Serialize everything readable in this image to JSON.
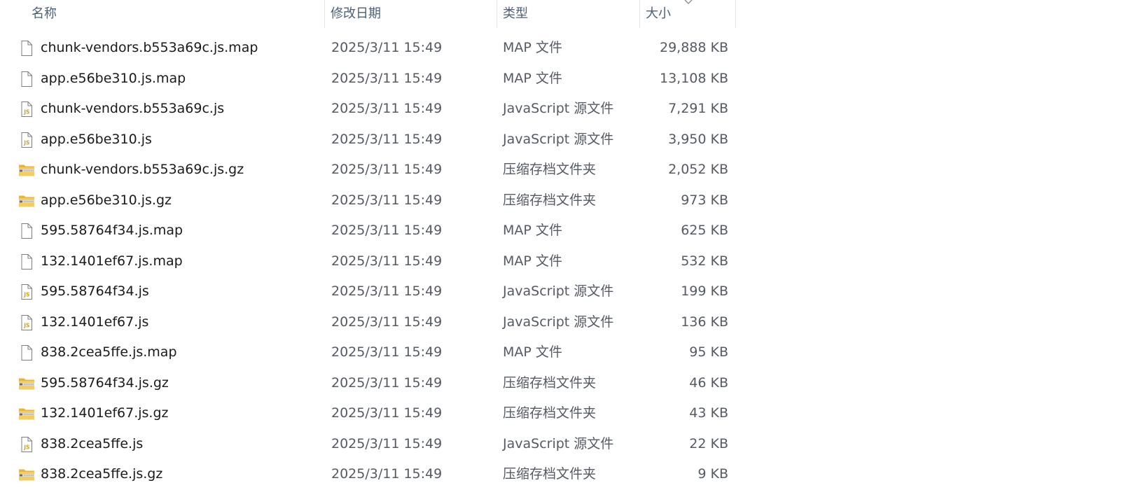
{
  "columns": {
    "name": "名称",
    "date": "修改日期",
    "type": "类型",
    "size": "大小"
  },
  "sort": {
    "column": "size",
    "direction": "descending",
    "icon": "chevron-down-icon"
  },
  "files": [
    {
      "name": "chunk-vendors.b553a69c.js.map",
      "date": "2025/3/11 15:49",
      "type": "MAP 文件",
      "size": "29,888 KB",
      "icon": "file-icon"
    },
    {
      "name": "app.e56be310.js.map",
      "date": "2025/3/11 15:49",
      "type": "MAP 文件",
      "size": "13,108 KB",
      "icon": "file-icon"
    },
    {
      "name": "chunk-vendors.b553a69c.js",
      "date": "2025/3/11 15:49",
      "type": "JavaScript 源文件",
      "size": "7,291 KB",
      "icon": "js-file-icon"
    },
    {
      "name": "app.e56be310.js",
      "date": "2025/3/11 15:49",
      "type": "JavaScript 源文件",
      "size": "3,950 KB",
      "icon": "js-file-icon"
    },
    {
      "name": "chunk-vendors.b553a69c.js.gz",
      "date": "2025/3/11 15:49",
      "type": "压缩存档文件夹",
      "size": "2,052 KB",
      "icon": "zip-folder-icon"
    },
    {
      "name": "app.e56be310.js.gz",
      "date": "2025/3/11 15:49",
      "type": "压缩存档文件夹",
      "size": "973 KB",
      "icon": "zip-folder-icon"
    },
    {
      "name": "595.58764f34.js.map",
      "date": "2025/3/11 15:49",
      "type": "MAP 文件",
      "size": "625 KB",
      "icon": "file-icon"
    },
    {
      "name": "132.1401ef67.js.map",
      "date": "2025/3/11 15:49",
      "type": "MAP 文件",
      "size": "532 KB",
      "icon": "file-icon"
    },
    {
      "name": "595.58764f34.js",
      "date": "2025/3/11 15:49",
      "type": "JavaScript 源文件",
      "size": "199 KB",
      "icon": "js-file-icon"
    },
    {
      "name": "132.1401ef67.js",
      "date": "2025/3/11 15:49",
      "type": "JavaScript 源文件",
      "size": "136 KB",
      "icon": "js-file-icon"
    },
    {
      "name": "838.2cea5ffe.js.map",
      "date": "2025/3/11 15:49",
      "type": "MAP 文件",
      "size": "95 KB",
      "icon": "file-icon"
    },
    {
      "name": "595.58764f34.js.gz",
      "date": "2025/3/11 15:49",
      "type": "压缩存档文件夹",
      "size": "46 KB",
      "icon": "zip-folder-icon"
    },
    {
      "name": "132.1401ef67.js.gz",
      "date": "2025/3/11 15:49",
      "type": "压缩存档文件夹",
      "size": "43 KB",
      "icon": "zip-folder-icon"
    },
    {
      "name": "838.2cea5ffe.js",
      "date": "2025/3/11 15:49",
      "type": "JavaScript 源文件",
      "size": "22 KB",
      "icon": "js-file-icon"
    },
    {
      "name": "838.2cea5ffe.js.gz",
      "date": "2025/3/11 15:49",
      "type": "压缩存档文件夹",
      "size": "9 KB",
      "icon": "zip-folder-icon"
    }
  ]
}
